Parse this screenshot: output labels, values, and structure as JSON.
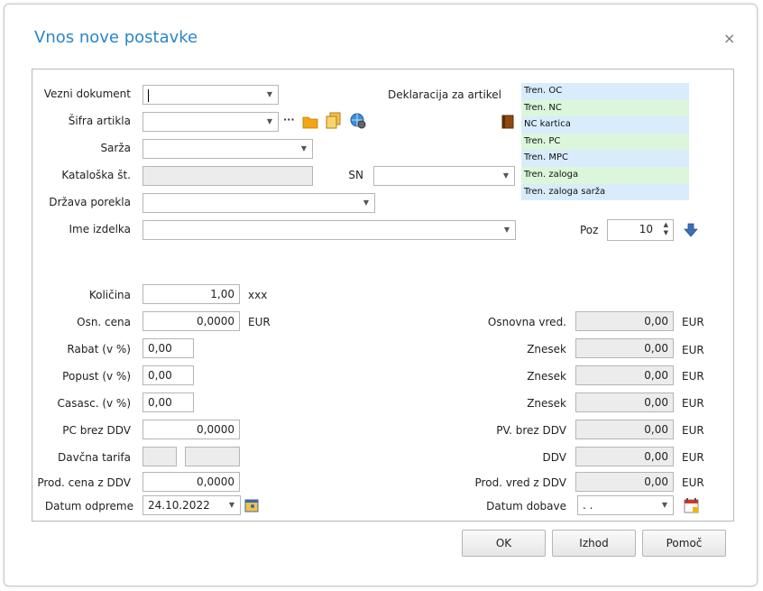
{
  "dialog": {
    "title": "Vnos nove postavke",
    "close_icon": "×"
  },
  "labels": {
    "vezni_dokument": "Vezni dokument",
    "sifra_artikla": "Šifra artikla",
    "sarza": "Sarža",
    "kataloska": "Kataloška št.",
    "sn": "SN",
    "drzava": "Država porekla",
    "ime_izdelka": "Ime izdelka",
    "deklaracija": "Deklaracija za artikel",
    "poz": "Poz",
    "kolicina": "Količina",
    "osn_cena": "Osn. cena",
    "rabat": "Rabat (v %)",
    "popust": "Popust (v %)",
    "casasc": "Casasc. (v %)",
    "pc_brez_ddv": "PC brez DDV",
    "davcna_tarifa": "Davčna tarifa",
    "prod_cena_z_ddv": "Prod. cena z DDV",
    "datum_odpreme": "Datum odpreme",
    "osnovna_vred": "Osnovna vred.",
    "znesek1": "Znesek",
    "znesek2": "Znesek",
    "znesek3": "Znesek",
    "pv_brez_ddv": "PV. brez DDV",
    "ddv": "DDV",
    "prod_vred_z_ddv": "Prod. vred z DDV",
    "datum_dobave": "Datum dobave"
  },
  "values": {
    "poz": "10",
    "kolicina": "1,00",
    "kolicina_unit": "xxx",
    "osn_cena": "0,0000",
    "osn_cena_unit": "EUR",
    "rabat": "0,00",
    "popust": "0,00",
    "casasc": "0,00",
    "pc_brez_ddv": "0,0000",
    "prod_cena_z_ddv": "0,0000",
    "datum_odpreme": "24.10.2022",
    "osnovna_vred": "0,00",
    "znesek1": "0,00",
    "znesek2": "0,00",
    "znesek3": "0,00",
    "pv_brez_ddv": "0,00",
    "ddv": "0,00",
    "prod_vred_z_ddv": "0,00",
    "datum_dobave": ". .",
    "currency": "EUR"
  },
  "legend": [
    {
      "label": "Tren. OC",
      "color": "#d9ecfb"
    },
    {
      "label": "Tren. NC",
      "color": "#dcf6dc"
    },
    {
      "label": "NC kartica",
      "color": "#d9ecfb"
    },
    {
      "label": "Tren. PC",
      "color": "#dcf6dc"
    },
    {
      "label": "Tren. MPC",
      "color": "#d9ecfb"
    },
    {
      "label": "Tren. zaloga",
      "color": "#dcf6dc"
    },
    {
      "label": "Tren. zaloga sarža",
      "color": "#d9ecfb"
    }
  ],
  "buttons": {
    "ok": "OK",
    "izhod": "Izhod",
    "pomoc": "Pomoč"
  },
  "icons": {
    "ellipsis": "···",
    "dropdown": "▼",
    "spin_up": "▲",
    "spin_down": "▼"
  }
}
